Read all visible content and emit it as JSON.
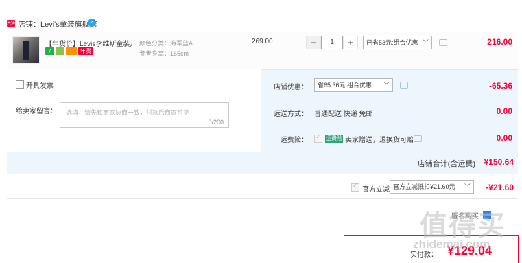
{
  "shop": {
    "badge": "天猫",
    "label": "店铺：Levi's童装旗舰店",
    "chat_icon": "chat-icon"
  },
  "item": {
    "title": "【年货价】Levis李维斯童装儿...",
    "badges": [
      "7",
      "",
      "",
      "年货"
    ],
    "sku_color": "颜色分类：海军蓝A",
    "sku_height": "参考身高：165cm",
    "unit_price": "269.00",
    "quantity": "1",
    "minus_label": "−",
    "plus_label": "+",
    "promo_select": "已省53元:组合优惠",
    "total": "216.00"
  },
  "options": {
    "invoice_label": "开具发票",
    "seller_msg_label": "给卖家留言：",
    "seller_msg_placeholder": "选填，请先和商家协商一致，付款后商家可见",
    "seller_msg_count": "0/200",
    "shop_discount_label": "店铺优惠：",
    "shop_discount_select": "省65.36元:组合优惠",
    "shop_discount_value": "-65.36",
    "shipping_label": "运送方式：",
    "shipping_text": "普通配送 快递 免邮",
    "shipping_value": "0.00",
    "insurance_label": "运费险：",
    "insurance_badge": "运费险",
    "insurance_text": "卖家赠送，退换货可赔",
    "insurance_value": "0.00"
  },
  "subtotal": {
    "label": "店铺合计(含运费)",
    "value": "¥150.64"
  },
  "official": {
    "label": "官方立减",
    "select": "官方立减抵扣¥21.60元",
    "value": "-¥21.60"
  },
  "bottom": {
    "left_label": "匿名购买",
    "right_label": "匿名购买"
  },
  "final": {
    "label": "实付款：",
    "value": "¥129.04"
  },
  "watermark": {
    "text": "值得买",
    "url": "zhidemai.com"
  }
}
